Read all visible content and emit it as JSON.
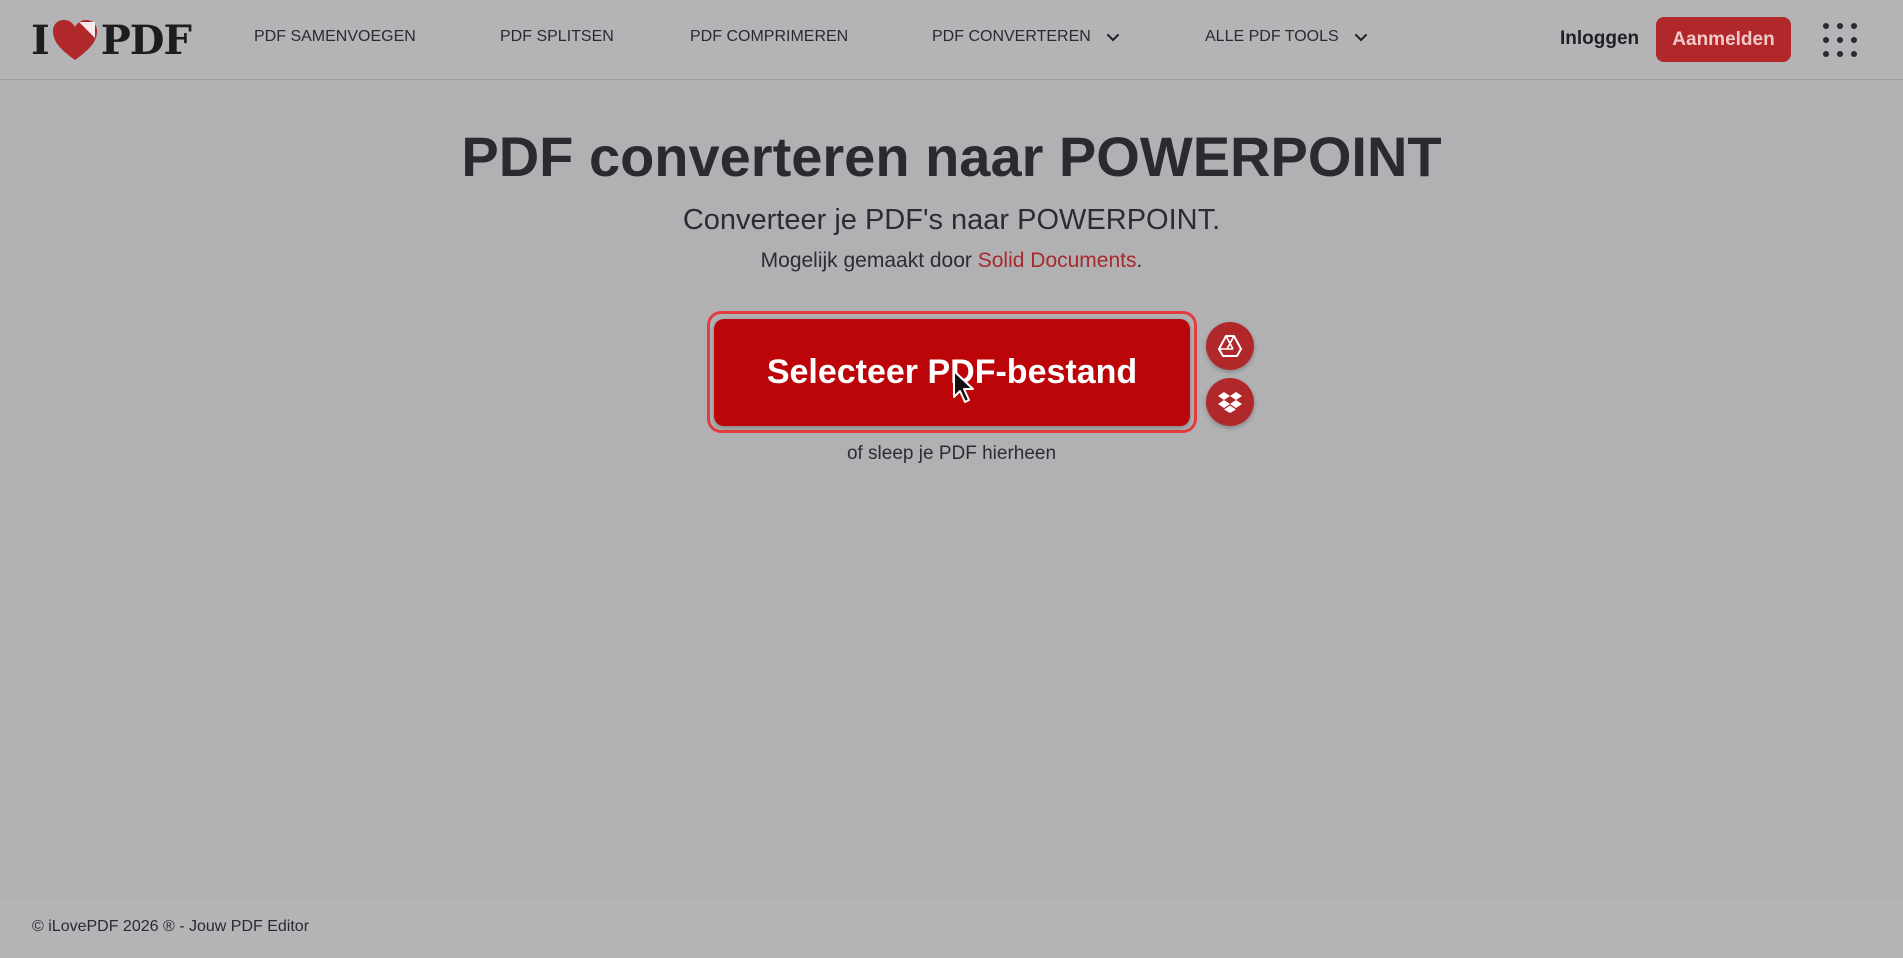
{
  "header": {
    "logo_left": "I",
    "logo_right": "PDF",
    "nav": [
      {
        "label": "PDF SAMENVOEGEN"
      },
      {
        "label": "PDF SPLITSEN"
      },
      {
        "label": "PDF COMPRIMEREN"
      },
      {
        "label": "PDF CONVERTEREN"
      },
      {
        "label": "ALLE PDF TOOLS"
      }
    ],
    "login_label": "Inloggen",
    "signup_label": "Aanmelden"
  },
  "main": {
    "title": "PDF converteren naar POWERPOINT",
    "subtitle": "Converteer je PDF's naar POWERPOINT.",
    "powered_prefix": "Mogelijk gemaakt door ",
    "powered_link": "Solid Documents",
    "powered_suffix": ".",
    "select_button_label": "Selecteer PDF-bestand",
    "drop_hint": "of sleep je PDF hierheen"
  },
  "footer": {
    "text": "© iLovePDF 2026 ® - Jouw PDF Editor"
  },
  "colors": {
    "brand_red": "#bb0509",
    "accent_red": "#b1282b",
    "link_red": "#a8292c"
  },
  "icons": {
    "cloud_1": "google-drive-icon",
    "cloud_2": "dropbox-icon",
    "apps": "apps-grid-icon"
  }
}
